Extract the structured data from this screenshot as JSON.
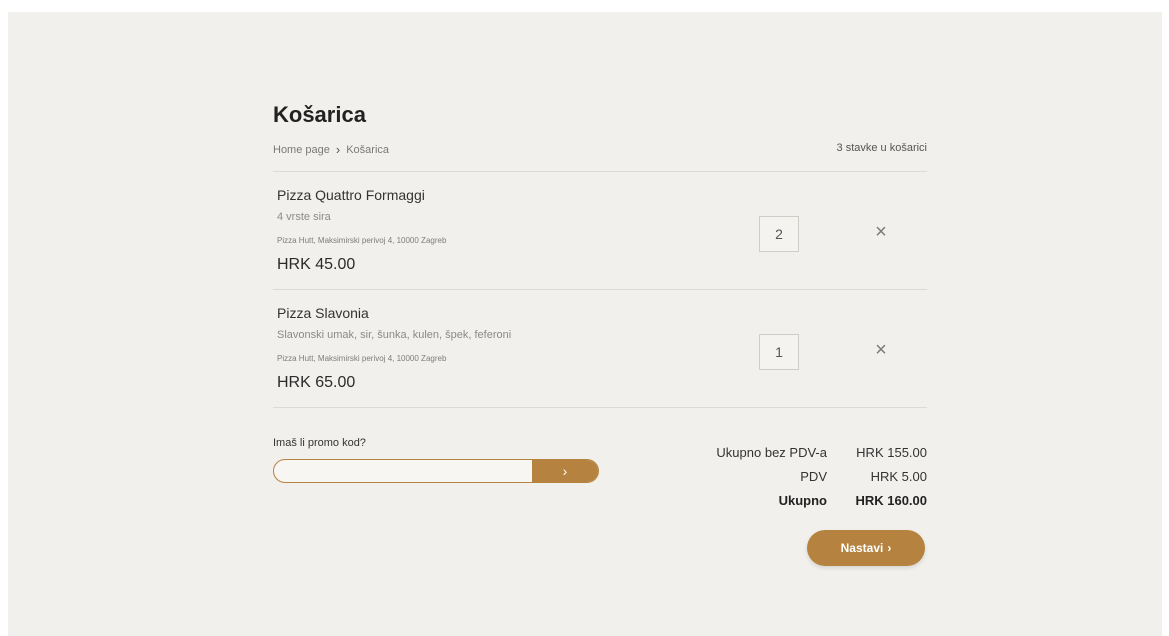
{
  "page": {
    "title": "Košarica",
    "breadcrumb": {
      "home": "Home page",
      "separator": "›",
      "current": "Košarica"
    },
    "item_count": "3 stavke u košarici"
  },
  "cart": {
    "items": [
      {
        "name": "Pizza Quattro Formaggi",
        "description": "4 vrste sira",
        "restaurant": "Pizza Hutt, Maksimirski perivoj 4, 10000 Zagreb",
        "price": "HRK 45.00",
        "quantity": "2",
        "remove_icon": "×"
      },
      {
        "name": "Pizza Slavonia",
        "description": "Slavonski umak, sir, šunka, kulen, špek, feferoni",
        "restaurant": "Pizza Hutt, Maksimirski perivoj 4, 10000 Zagreb",
        "price": "HRK 65.00",
        "quantity": "1",
        "remove_icon": "×"
      }
    ]
  },
  "promo": {
    "label": "Imaš li promo kod?",
    "value": "",
    "placeholder": "",
    "submit_icon": "›"
  },
  "totals": {
    "subtotal_label": "Ukupno bez PDV-a",
    "subtotal_value": "HRK 155.00",
    "tax_label": "PDV",
    "tax_value": "HRK 5.00",
    "total_label": "Ukupno",
    "total_value": "HRK 160.00"
  },
  "actions": {
    "continue_label": "Nastavi",
    "continue_icon": "›"
  },
  "colors": {
    "accent": "#b5833f",
    "background": "#f1f0ec",
    "divider": "#dcdad5"
  }
}
